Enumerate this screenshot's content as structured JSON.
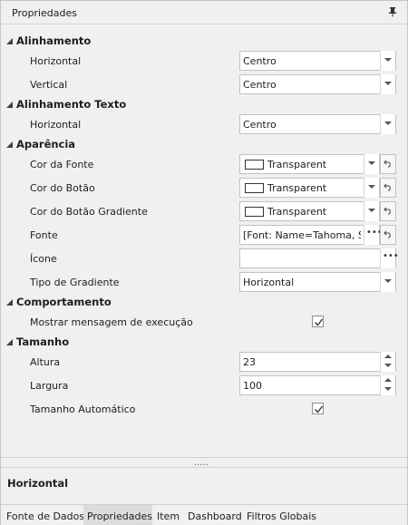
{
  "panel": {
    "title": "Propriedades",
    "pin_icon": "pin-icon"
  },
  "categories": {
    "alinhamento": "Alinhamento",
    "alinhamento_texto": "Alinhamento Texto",
    "aparencia": "Aparência",
    "comportamento": "Comportamento",
    "tamanho": "Tamanho"
  },
  "props": {
    "horizontal": {
      "label": "Horizontal",
      "value": "Centro"
    },
    "vertical": {
      "label": "Vertical",
      "value": "Centro"
    },
    "texto_horizontal": {
      "label": "Horizontal",
      "value": "Centro"
    },
    "cor_fonte": {
      "label": "Cor da Fonte",
      "value": "Transparent"
    },
    "cor_botao": {
      "label": "Cor do Botão",
      "value": "Transparent"
    },
    "cor_botao_gradiente": {
      "label": "Cor do Botão Gradiente",
      "value": "Transparent"
    },
    "fonte": {
      "label": "Fonte",
      "value": "[Font: Name=Tahoma, Si..."
    },
    "icone": {
      "label": "Ícone",
      "value": ""
    },
    "tipo_gradiente": {
      "label": "Tipo de Gradiente",
      "value": "Horizontal"
    },
    "mostrar_mensagem": {
      "label": "Mostrar mensagem de execução",
      "checked": true
    },
    "altura": {
      "label": "Altura",
      "value": "23"
    },
    "largura": {
      "label": "Largura",
      "value": "100"
    },
    "tamanho_automatico": {
      "label": "Tamanho Automático",
      "checked": true
    }
  },
  "splitter": {
    "grip": "....."
  },
  "description": {
    "title": "Horizontal"
  },
  "tabs": [
    {
      "label": "Fonte de Dados",
      "active": false
    },
    {
      "label": "Propriedades",
      "active": true
    },
    {
      "label": "Item",
      "active": false
    },
    {
      "label": "Dashboard",
      "active": false
    },
    {
      "label": "Filtros Globais",
      "active": false
    }
  ],
  "icons": {
    "expander": "collapse-triangle-icon",
    "dropdown": "chevron-down-icon",
    "reset": "reset-icon",
    "ellipsis": "ellipsis-icon",
    "check": "checkmark-icon"
  }
}
